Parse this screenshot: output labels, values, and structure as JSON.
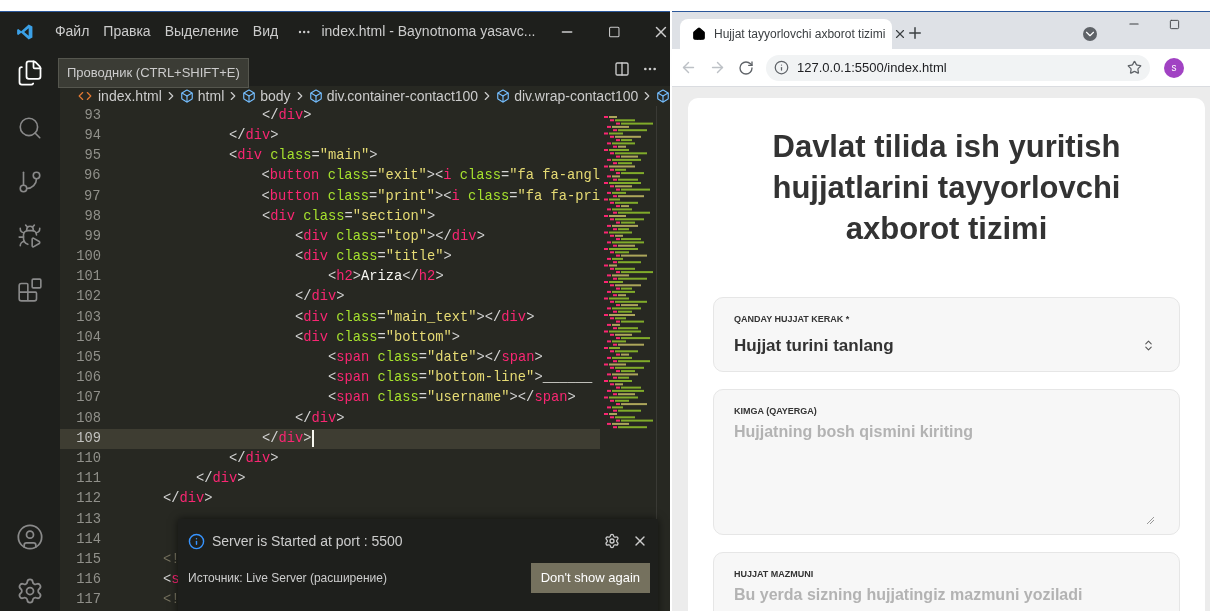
{
  "vscode": {
    "menu": [
      "Файл",
      "Правка",
      "Выделение",
      "Вид"
    ],
    "title": "index.html - Baynotnoma yasavc...",
    "tooltip": "Проводник (CTRL+SHIFT+E)",
    "breadcrumbs": [
      {
        "kind": "file",
        "label": "index.html"
      },
      {
        "kind": "element",
        "label": "html"
      },
      {
        "kind": "element",
        "label": "body"
      },
      {
        "kind": "element",
        "label": "div.container-contact100"
      },
      {
        "kind": "element",
        "label": "div.wrap-contact100"
      },
      {
        "kind": "element"
      }
    ],
    "code_lines": [
      {
        "number": "93",
        "current": false,
        "tokens": [
          {
            "kind": "punct",
            "text": "                </"
          },
          {
            "kind": "tag",
            "text": "div"
          },
          {
            "kind": "punct",
            "text": ">"
          }
        ]
      },
      {
        "number": "94",
        "current": false,
        "tokens": [
          {
            "kind": "punct",
            "text": "            </"
          },
          {
            "kind": "tag",
            "text": "div"
          },
          {
            "kind": "punct",
            "text": ">"
          }
        ]
      },
      {
        "number": "95",
        "current": false,
        "tokens": [
          {
            "kind": "punct",
            "text": "            <"
          },
          {
            "kind": "tag",
            "text": "div"
          },
          {
            "kind": "attr",
            "text": " class"
          },
          {
            "kind": "punct",
            "text": "="
          },
          {
            "kind": "string",
            "text": "\"main\""
          },
          {
            "kind": "punct",
            "text": ">"
          }
        ]
      },
      {
        "number": "96",
        "current": false,
        "tokens": [
          {
            "kind": "punct",
            "text": "                <"
          },
          {
            "kind": "tag",
            "text": "button"
          },
          {
            "kind": "attr",
            "text": " class"
          },
          {
            "kind": "punct",
            "text": "="
          },
          {
            "kind": "string",
            "text": "\"exit\""
          },
          {
            "kind": "punct",
            "text": "><"
          },
          {
            "kind": "tag",
            "text": "i"
          },
          {
            "kind": "attr",
            "text": " class"
          },
          {
            "kind": "punct",
            "text": "="
          },
          {
            "kind": "string",
            "text": "\"fa fa-angl"
          }
        ]
      },
      {
        "number": "97",
        "current": false,
        "tokens": [
          {
            "kind": "punct",
            "text": "                <"
          },
          {
            "kind": "tag",
            "text": "button"
          },
          {
            "kind": "attr",
            "text": " class"
          },
          {
            "kind": "punct",
            "text": "="
          },
          {
            "kind": "string",
            "text": "\"print\""
          },
          {
            "kind": "punct",
            "text": "><"
          },
          {
            "kind": "tag",
            "text": "i"
          },
          {
            "kind": "attr",
            "text": " class"
          },
          {
            "kind": "punct",
            "text": "="
          },
          {
            "kind": "string",
            "text": "\"fa fa-pri"
          }
        ]
      },
      {
        "number": "98",
        "current": false,
        "tokens": [
          {
            "kind": "punct",
            "text": "                <"
          },
          {
            "kind": "tag",
            "text": "div"
          },
          {
            "kind": "attr",
            "text": " class"
          },
          {
            "kind": "punct",
            "text": "="
          },
          {
            "kind": "string",
            "text": "\"section\""
          },
          {
            "kind": "punct",
            "text": ">"
          }
        ]
      },
      {
        "number": "99",
        "current": false,
        "tokens": [
          {
            "kind": "punct",
            "text": "                    <"
          },
          {
            "kind": "tag",
            "text": "div"
          },
          {
            "kind": "attr",
            "text": " class"
          },
          {
            "kind": "punct",
            "text": "="
          },
          {
            "kind": "string",
            "text": "\"top\""
          },
          {
            "kind": "punct",
            "text": "></"
          },
          {
            "kind": "tag",
            "text": "div"
          },
          {
            "kind": "punct",
            "text": ">"
          }
        ]
      },
      {
        "number": "100",
        "current": false,
        "tokens": [
          {
            "kind": "punct",
            "text": "                    <"
          },
          {
            "kind": "tag",
            "text": "div"
          },
          {
            "kind": "attr",
            "text": " class"
          },
          {
            "kind": "punct",
            "text": "="
          },
          {
            "kind": "string",
            "text": "\"title\""
          },
          {
            "kind": "punct",
            "text": ">"
          }
        ]
      },
      {
        "number": "101",
        "current": false,
        "tokens": [
          {
            "kind": "punct",
            "text": "                        <"
          },
          {
            "kind": "tag",
            "text": "h2"
          },
          {
            "kind": "punct",
            "text": ">"
          },
          {
            "kind": "text",
            "text": "Ariza"
          },
          {
            "kind": "punct",
            "text": "</"
          },
          {
            "kind": "tag",
            "text": "h2"
          },
          {
            "kind": "punct",
            "text": ">"
          }
        ]
      },
      {
        "number": "102",
        "current": false,
        "tokens": [
          {
            "kind": "punct",
            "text": "                    </"
          },
          {
            "kind": "tag",
            "text": "div"
          },
          {
            "kind": "punct",
            "text": ">"
          }
        ]
      },
      {
        "number": "103",
        "current": false,
        "tokens": [
          {
            "kind": "punct",
            "text": "                    <"
          },
          {
            "kind": "tag",
            "text": "div"
          },
          {
            "kind": "attr",
            "text": " class"
          },
          {
            "kind": "punct",
            "text": "="
          },
          {
            "kind": "string",
            "text": "\"main_text\""
          },
          {
            "kind": "punct",
            "text": "></"
          },
          {
            "kind": "tag",
            "text": "div"
          },
          {
            "kind": "punct",
            "text": ">"
          }
        ]
      },
      {
        "number": "104",
        "current": false,
        "tokens": [
          {
            "kind": "punct",
            "text": "                    <"
          },
          {
            "kind": "tag",
            "text": "div"
          },
          {
            "kind": "attr",
            "text": " class"
          },
          {
            "kind": "punct",
            "text": "="
          },
          {
            "kind": "string",
            "text": "\"bottom\""
          },
          {
            "kind": "punct",
            "text": ">"
          }
        ]
      },
      {
        "number": "105",
        "current": false,
        "tokens": [
          {
            "kind": "punct",
            "text": "                        <"
          },
          {
            "kind": "tag",
            "text": "span"
          },
          {
            "kind": "attr",
            "text": " class"
          },
          {
            "kind": "punct",
            "text": "="
          },
          {
            "kind": "string",
            "text": "\"date\""
          },
          {
            "kind": "punct",
            "text": "></"
          },
          {
            "kind": "tag",
            "text": "span"
          },
          {
            "kind": "punct",
            "text": ">"
          }
        ]
      },
      {
        "number": "106",
        "current": false,
        "tokens": [
          {
            "kind": "punct",
            "text": "                        <"
          },
          {
            "kind": "tag",
            "text": "span"
          },
          {
            "kind": "attr",
            "text": " class"
          },
          {
            "kind": "punct",
            "text": "="
          },
          {
            "kind": "string",
            "text": "\"bottom-line\""
          },
          {
            "kind": "punct",
            "text": ">"
          },
          {
            "kind": "text",
            "text": "______"
          }
        ]
      },
      {
        "number": "107",
        "current": false,
        "tokens": [
          {
            "kind": "punct",
            "text": "                        <"
          },
          {
            "kind": "tag",
            "text": "span"
          },
          {
            "kind": "attr",
            "text": " class"
          },
          {
            "kind": "punct",
            "text": "="
          },
          {
            "kind": "string",
            "text": "\"username\""
          },
          {
            "kind": "punct",
            "text": "></"
          },
          {
            "kind": "tag",
            "text": "span"
          },
          {
            "kind": "punct",
            "text": ">"
          }
        ]
      },
      {
        "number": "108",
        "current": false,
        "tokens": [
          {
            "kind": "punct",
            "text": "                    </"
          },
          {
            "kind": "tag",
            "text": "div"
          },
          {
            "kind": "punct",
            "text": ">"
          }
        ]
      },
      {
        "number": "109",
        "current": true,
        "tokens": [
          {
            "kind": "punct",
            "text": "                </"
          },
          {
            "kind": "tag",
            "text": "div"
          },
          {
            "kind": "punct",
            "text": ">"
          }
        ]
      },
      {
        "number": "110",
        "current": false,
        "tokens": [
          {
            "kind": "punct",
            "text": "            </"
          },
          {
            "kind": "tag",
            "text": "div"
          },
          {
            "kind": "punct",
            "text": ">"
          }
        ]
      },
      {
        "number": "111",
        "current": false,
        "tokens": [
          {
            "kind": "punct",
            "text": "        </"
          },
          {
            "kind": "tag",
            "text": "div"
          },
          {
            "kind": "punct",
            "text": ">"
          }
        ]
      },
      {
        "number": "112",
        "current": false,
        "tokens": [
          {
            "kind": "punct",
            "text": "    </"
          },
          {
            "kind": "tag",
            "text": "div"
          },
          {
            "kind": "punct",
            "text": ">"
          }
        ]
      },
      {
        "number": "113",
        "current": false
      },
      {
        "number": "114",
        "current": false
      },
      {
        "number": "115",
        "current": false,
        "tokens": [
          {
            "kind": "comment",
            "text": "    <!"
          }
        ]
      },
      {
        "number": "116",
        "current": false,
        "tokens": [
          {
            "kind": "punct",
            "text": "    <"
          },
          {
            "kind": "tag",
            "text": "s"
          }
        ]
      },
      {
        "number": "117",
        "current": false,
        "tokens": [
          {
            "kind": "comment",
            "text": "    <!"
          }
        ]
      }
    ],
    "notification": {
      "message": "Server is Started at port : 5500",
      "source": "Источник: Live Server (расширение)",
      "button": "Don't show again"
    }
  },
  "browser": {
    "tab": {
      "title": "Hujjat tayyorlovchi axborot tizimi"
    },
    "url": "127.0.0.1:5500/index.html",
    "avatar": "s",
    "page": {
      "heading": "Davlat tilida ish yuritish hujjatlarini tayyorlovchi axborot tizimi",
      "fields": [
        {
          "kind": "select",
          "label": "QANDAY HUJJAT KERAK *",
          "value": "Hujjat turini tanlang"
        },
        {
          "kind": "textarea",
          "label": "KIMGA (QAYERGA)",
          "placeholder": "Hujjatning bosh qismini kiriting"
        },
        {
          "kind": "textarea",
          "label": "HUJJAT MAZMUNI",
          "placeholder": "Bu yerda sizning hujjatingiz mazmuni yoziladi"
        }
      ]
    }
  }
}
